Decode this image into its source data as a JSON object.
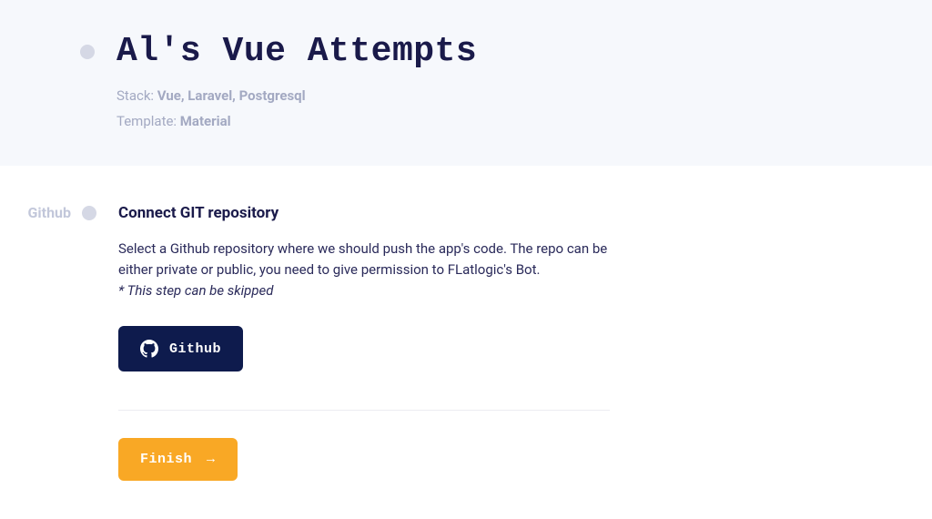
{
  "header": {
    "title": "Al's Vue Attempts",
    "stack_label": "Stack: ",
    "stack_value": "Vue, Laravel, Postgresql",
    "template_label": "Template: ",
    "template_value": "Material"
  },
  "step": {
    "label": "Github",
    "heading": "Connect GIT repository",
    "description": "Select a Github repository where we should push the app's code. The repo can be either private or public, you need to give permission to FLatlogic's Bot.",
    "note": "* This step can be skipped",
    "github_button_label": "Github",
    "finish_button_label": "Finish"
  }
}
